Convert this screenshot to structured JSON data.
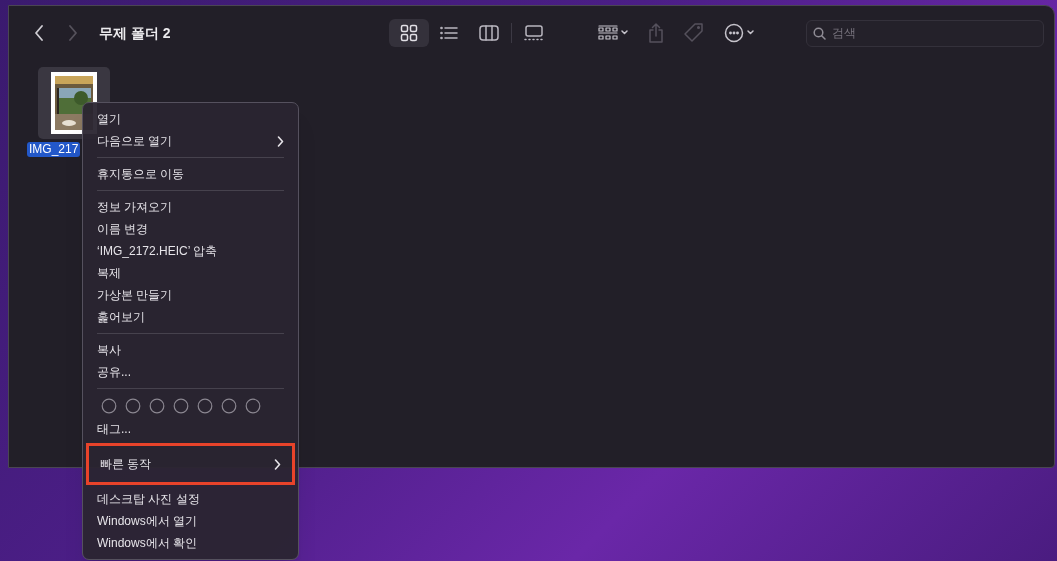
{
  "toolbar": {
    "back": {
      "disabled": false
    },
    "forward": {
      "disabled": true
    },
    "title": "무제 폴더 2",
    "views": [
      {
        "kind": "icons",
        "selected": true
      },
      {
        "kind": "list",
        "selected": false
      },
      {
        "kind": "columns",
        "selected": false
      },
      {
        "kind": "gallery",
        "selected": false
      }
    ],
    "actions": [
      {
        "kind": "group",
        "disabled": false
      },
      {
        "kind": "share",
        "disabled": true
      },
      {
        "kind": "tag",
        "disabled": true
      },
      {
        "kind": "more",
        "disabled": false
      }
    ],
    "search": {
      "placeholder": "검색"
    }
  },
  "files": [
    {
      "name": "IMG_217",
      "selected": true
    }
  ],
  "context_menu": {
    "items": [
      {
        "kind": "item",
        "label": "열기",
        "submenu": false,
        "annotated": false
      },
      {
        "kind": "item",
        "label": "다음으로 열기",
        "submenu": true,
        "annotated": false
      },
      {
        "kind": "separator"
      },
      {
        "kind": "item",
        "label": "휴지통으로 이동",
        "submenu": false,
        "annotated": false
      },
      {
        "kind": "separator"
      },
      {
        "kind": "item",
        "label": "정보 가져오기",
        "submenu": false,
        "annotated": false
      },
      {
        "kind": "item",
        "label": "이름 변경",
        "submenu": false,
        "annotated": false
      },
      {
        "kind": "item",
        "label": "‘IMG_2172.HEIC’ 압축",
        "submenu": false,
        "annotated": false
      },
      {
        "kind": "item",
        "label": "복제",
        "submenu": false,
        "annotated": false
      },
      {
        "kind": "item",
        "label": "가상본 만들기",
        "submenu": false,
        "annotated": false
      },
      {
        "kind": "item",
        "label": "훑어보기",
        "submenu": false,
        "annotated": false
      },
      {
        "kind": "separator"
      },
      {
        "kind": "item",
        "label": "복사",
        "submenu": false,
        "annotated": false
      },
      {
        "kind": "item",
        "label": "공유...",
        "submenu": false,
        "annotated": false
      },
      {
        "kind": "separator"
      },
      {
        "kind": "tags"
      },
      {
        "kind": "item",
        "label": "태그...",
        "submenu": false,
        "annotated": false
      },
      {
        "kind": "item",
        "label": "빠른 동작",
        "submenu": true,
        "annotated": true
      },
      {
        "kind": "item",
        "label": "데스크탑 사진 설정",
        "submenu": false,
        "annotated": false
      },
      {
        "kind": "item",
        "label": "Windows에서 열기",
        "submenu": false,
        "annotated": false
      },
      {
        "kind": "item",
        "label": "Windows에서 확인",
        "submenu": false,
        "annotated": false
      }
    ]
  }
}
